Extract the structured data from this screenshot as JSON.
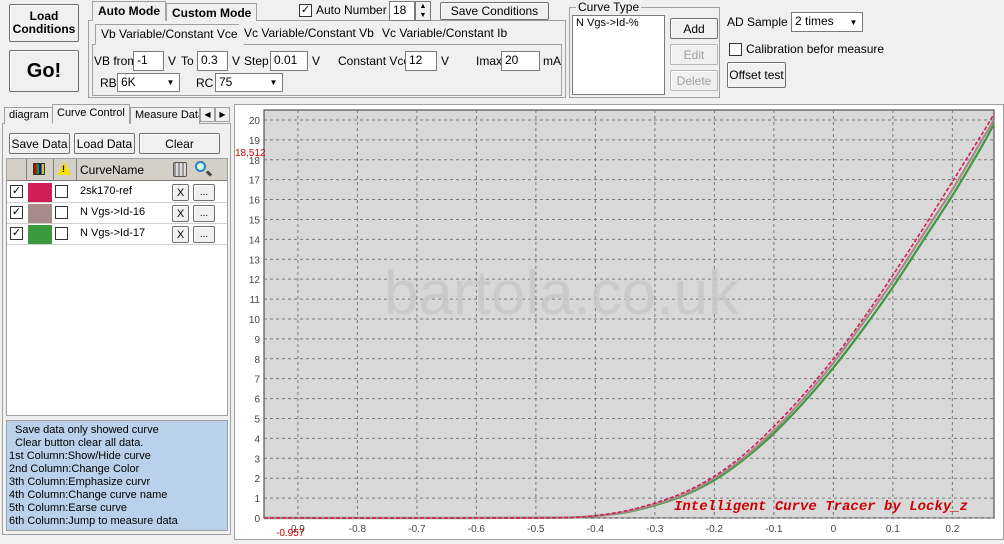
{
  "toolbar": {
    "load_conditions": [
      "Load",
      "Conditions"
    ],
    "go": "Go!",
    "mode_tabs": [
      "Auto Mode",
      "Custom Mode"
    ],
    "auto_number_label": "Auto Number",
    "auto_number_checked": true,
    "auto_number_value": "18",
    "save_conditions": "Save Conditions",
    "vb_tabs": [
      "Vb Variable/Constant Vce",
      "Vc Variable/Constant Vb",
      "Vc Variable/Constant Ib"
    ],
    "vb_from_label": "VB from",
    "vb_from_value": "-1",
    "v_unit": "V",
    "to_label": "To",
    "to_value": "0.3",
    "step_label": "Step",
    "step_value": "0.01",
    "constant_vce_label": "Constant Vce",
    "constant_vce_value": "12",
    "imax_label": "Imax",
    "imax_value": "20",
    "ma_unit": "mA",
    "rb_label": "RB",
    "rb_value": "6K",
    "rc_label": "RC",
    "rc_value": "75"
  },
  "curve_type": {
    "title": "Curve Type",
    "items": [
      "N Vgs->Id-%"
    ],
    "add": "Add",
    "edit": "Edit",
    "delete": "Delete"
  },
  "ad": {
    "label": "AD Sample",
    "value": "2 times",
    "calibration_label": "Calibration befor measure",
    "calibration_checked": false,
    "offset": "Offset test"
  },
  "left_panel": {
    "tabs": [
      "diagram",
      "Curve Control",
      "Measure Data"
    ],
    "save_data": "Save Data",
    "load_data": "Load Data",
    "clear": "Clear",
    "col_curve_name": "CurveName",
    "x_label": "X",
    "dots_label": "...",
    "curves": [
      {
        "name": "2sk170-ref",
        "color": "#d01f57",
        "shown": true
      },
      {
        "name": "N Vgs->Id-16",
        "color": "#a88a8a",
        "shown": true
      },
      {
        "name": "N Vgs->Id-17",
        "color": "#3c9a3e",
        "shown": true
      }
    ],
    "help_lines": [
      "Save data only showed curve",
      " Clear button clear all data.",
      "1st Column:Show/Hide curve",
      "2nd Column:Change Color",
      "3th Column:Emphasize curvr",
      "4th Column:Change curve name",
      "5th Column:Earse curve",
      "6th Column:Jump to measure data"
    ]
  },
  "plot": {
    "cursor_y": "18,512",
    "cursor_x": "-0.957",
    "watermark": "bartola.co.uk",
    "credit": "Intelligent Curve Tracer by Locky_z",
    "accent_color": "#cc0000",
    "background": "#d8d8d8"
  },
  "chart_data": {
    "type": "line",
    "xlim": [
      -0.957,
      0.27
    ],
    "ylim": [
      0,
      20.5
    ],
    "x_ticks": [
      "0.9",
      "-0.8",
      "-0.7",
      "-0.6",
      "-0.5",
      "-0.4",
      "-0.3",
      "-0.2",
      "-0.1",
      "0",
      "0.1",
      "0.2"
    ],
    "x_tick_values": [
      -0.9,
      -0.8,
      -0.7,
      -0.6,
      -0.5,
      -0.4,
      -0.3,
      -0.2,
      -0.1,
      0,
      0.1,
      0.2
    ],
    "y_ticks": [
      "0",
      "1",
      "2",
      "3",
      "4",
      "5",
      "6",
      "7",
      "8",
      "9",
      "10",
      "11",
      "12",
      "13",
      "14",
      "15",
      "16",
      "17",
      "18",
      "19",
      "20"
    ],
    "grid": true,
    "x": [
      -0.957,
      -0.6,
      -0.45,
      -0.4,
      -0.35,
      -0.3,
      -0.25,
      -0.2,
      -0.15,
      -0.1,
      -0.05,
      0,
      0.05,
      0.1,
      0.15,
      0.2,
      0.25,
      0.27
    ],
    "series": [
      {
        "name": "2sk170-ref",
        "values": [
          0,
          0,
          0.02,
          0.12,
          0.35,
          0.75,
          1.3,
          2.1,
          3.2,
          4.6,
          6.2,
          8.0,
          10.0,
          12.2,
          14.5,
          16.9,
          19.3,
          20.3
        ]
      },
      {
        "name": "N Vgs->Id-16",
        "values": [
          0,
          0,
          0.02,
          0.1,
          0.3,
          0.68,
          1.2,
          2.0,
          3.05,
          4.4,
          6.0,
          7.8,
          9.8,
          11.9,
          14.2,
          16.5,
          19.0,
          20.0
        ]
      },
      {
        "name": "N Vgs->Id-17",
        "values": [
          0,
          0,
          0.02,
          0.1,
          0.28,
          0.64,
          1.15,
          1.9,
          2.95,
          4.25,
          5.8,
          7.55,
          9.5,
          11.6,
          13.9,
          16.2,
          18.7,
          19.8
        ]
      }
    ]
  }
}
